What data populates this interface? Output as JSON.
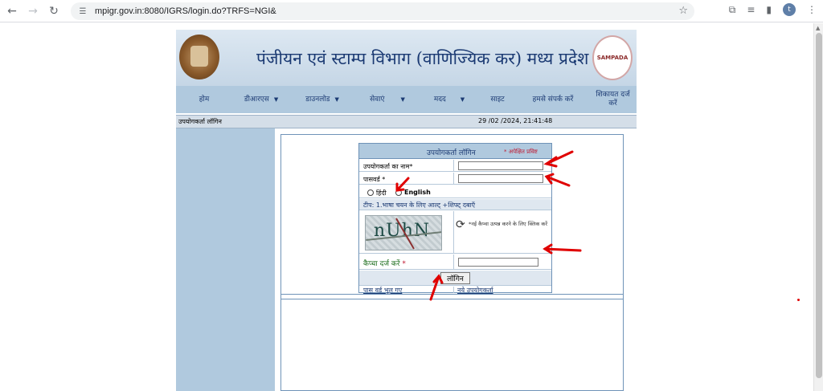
{
  "browser": {
    "url": "mpigr.gov.in:8080/IGRS/login.do?TRFS=NGI&",
    "profile_initial": "t"
  },
  "header": {
    "title": "पंजीयन एवं स्टाम्प विभाग (वाणिज्यिक कर) मध्य प्रदेश",
    "logo_text": "SAMPADA"
  },
  "menu": {
    "items": [
      {
        "label": "होम",
        "has_dropdown": false
      },
      {
        "label": "डीआरएस",
        "has_dropdown": true
      },
      {
        "label": "डाउनलोड",
        "has_dropdown": true
      },
      {
        "label": "सेवाएं",
        "has_dropdown": true
      },
      {
        "label": "मदद",
        "has_dropdown": true
      },
      {
        "label": "साइट",
        "has_dropdown": false
      },
      {
        "label": "हमसे संपर्क करें",
        "has_dropdown": false
      },
      {
        "label": "शिकायत दर्ज करें",
        "has_dropdown": false
      }
    ]
  },
  "status": {
    "user_login": "उपयोगकर्ता लॉगिन",
    "datetime": "29 /02 /2024, 21:41:48"
  },
  "login": {
    "title": "उपयोगकर्ता लॉगिन",
    "required_note": "* अपेक्षित प्रविष्ट",
    "username_label": "उपयोगकर्ता का नाम*",
    "username_value": "",
    "password_label": "पासवर्ड *",
    "password_value": "",
    "lang_hindi": "हिंदी",
    "lang_english": "English",
    "tip": "टीप: 1.भाषा चयन के लिए आल्ट् +शिफ्ट् दबाएँ",
    "captcha_chars": "nUhN",
    "captcha_refresh_text": "*नई कैप्चा उत्पन्न करने के लिए क्लिक करें",
    "captcha_label": "कैप्चा दर्ज करें",
    "captcha_value": "",
    "login_button": "लॉगिन",
    "forgot_password": "पास वर्ड भूल गए",
    "new_user": "नये उपयोगकर्ता"
  },
  "colors": {
    "menu_bg": "#b0c9de",
    "title_color": "#1b3a73",
    "arrow_color": "#e00000"
  }
}
